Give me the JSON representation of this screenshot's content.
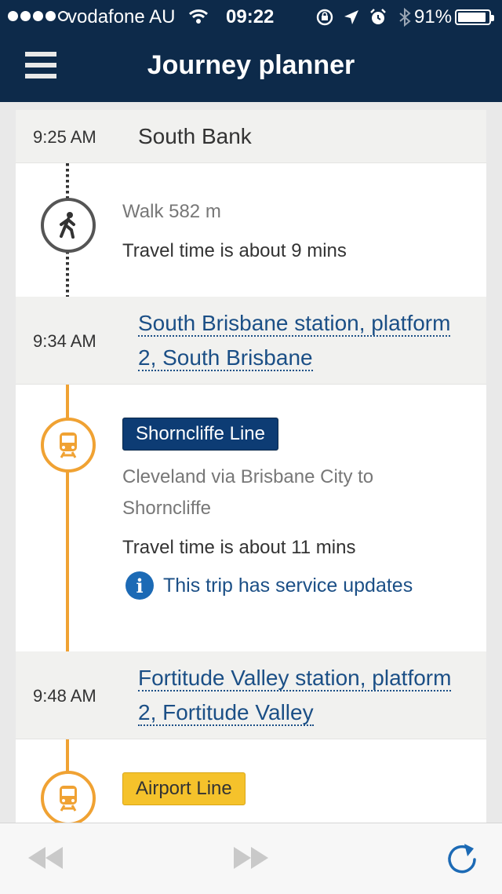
{
  "status_bar": {
    "carrier": "vodafone AU",
    "time": "09:22",
    "battery_percent": "91%",
    "battery_level": 0.91
  },
  "header": {
    "title": "Journey planner"
  },
  "stops": [
    {
      "time": "9:25 AM",
      "name": "South Bank"
    },
    {
      "time": "9:34 AM",
      "name_line1": "South Brisbane station, platform",
      "name_line2": "2, South Brisbane"
    },
    {
      "time": "9:48 AM",
      "name_line1": "Fortitude Valley station, platform",
      "name_line2": "2, Fortitude Valley"
    }
  ],
  "legs": [
    {
      "mode": "walk",
      "icon": "walking-person-icon",
      "summary": "Walk 582 m",
      "travel_time": "Travel time is about 9 mins"
    },
    {
      "mode": "train",
      "icon": "train-icon",
      "line_name": "Shorncliffe Line",
      "line_color": "#0d3c74",
      "direction_line1": "Cleveland via Brisbane City to",
      "direction_line2": "Shorncliffe",
      "travel_time": "Travel time is about 11 mins",
      "service_update": "This trip has service updates"
    },
    {
      "mode": "train",
      "icon": "train-icon",
      "line_name": "Airport Line",
      "line_color": "#f5c22b"
    }
  ],
  "colors": {
    "header_bg": "#0d2a4a",
    "train_accent": "#f0a233",
    "link": "#1b4f86",
    "info": "#1c6ab5"
  },
  "bottom_bar": {
    "back_icon": "rewind-icon",
    "forward_icon": "fast-forward-icon",
    "refresh_icon": "refresh-icon"
  }
}
